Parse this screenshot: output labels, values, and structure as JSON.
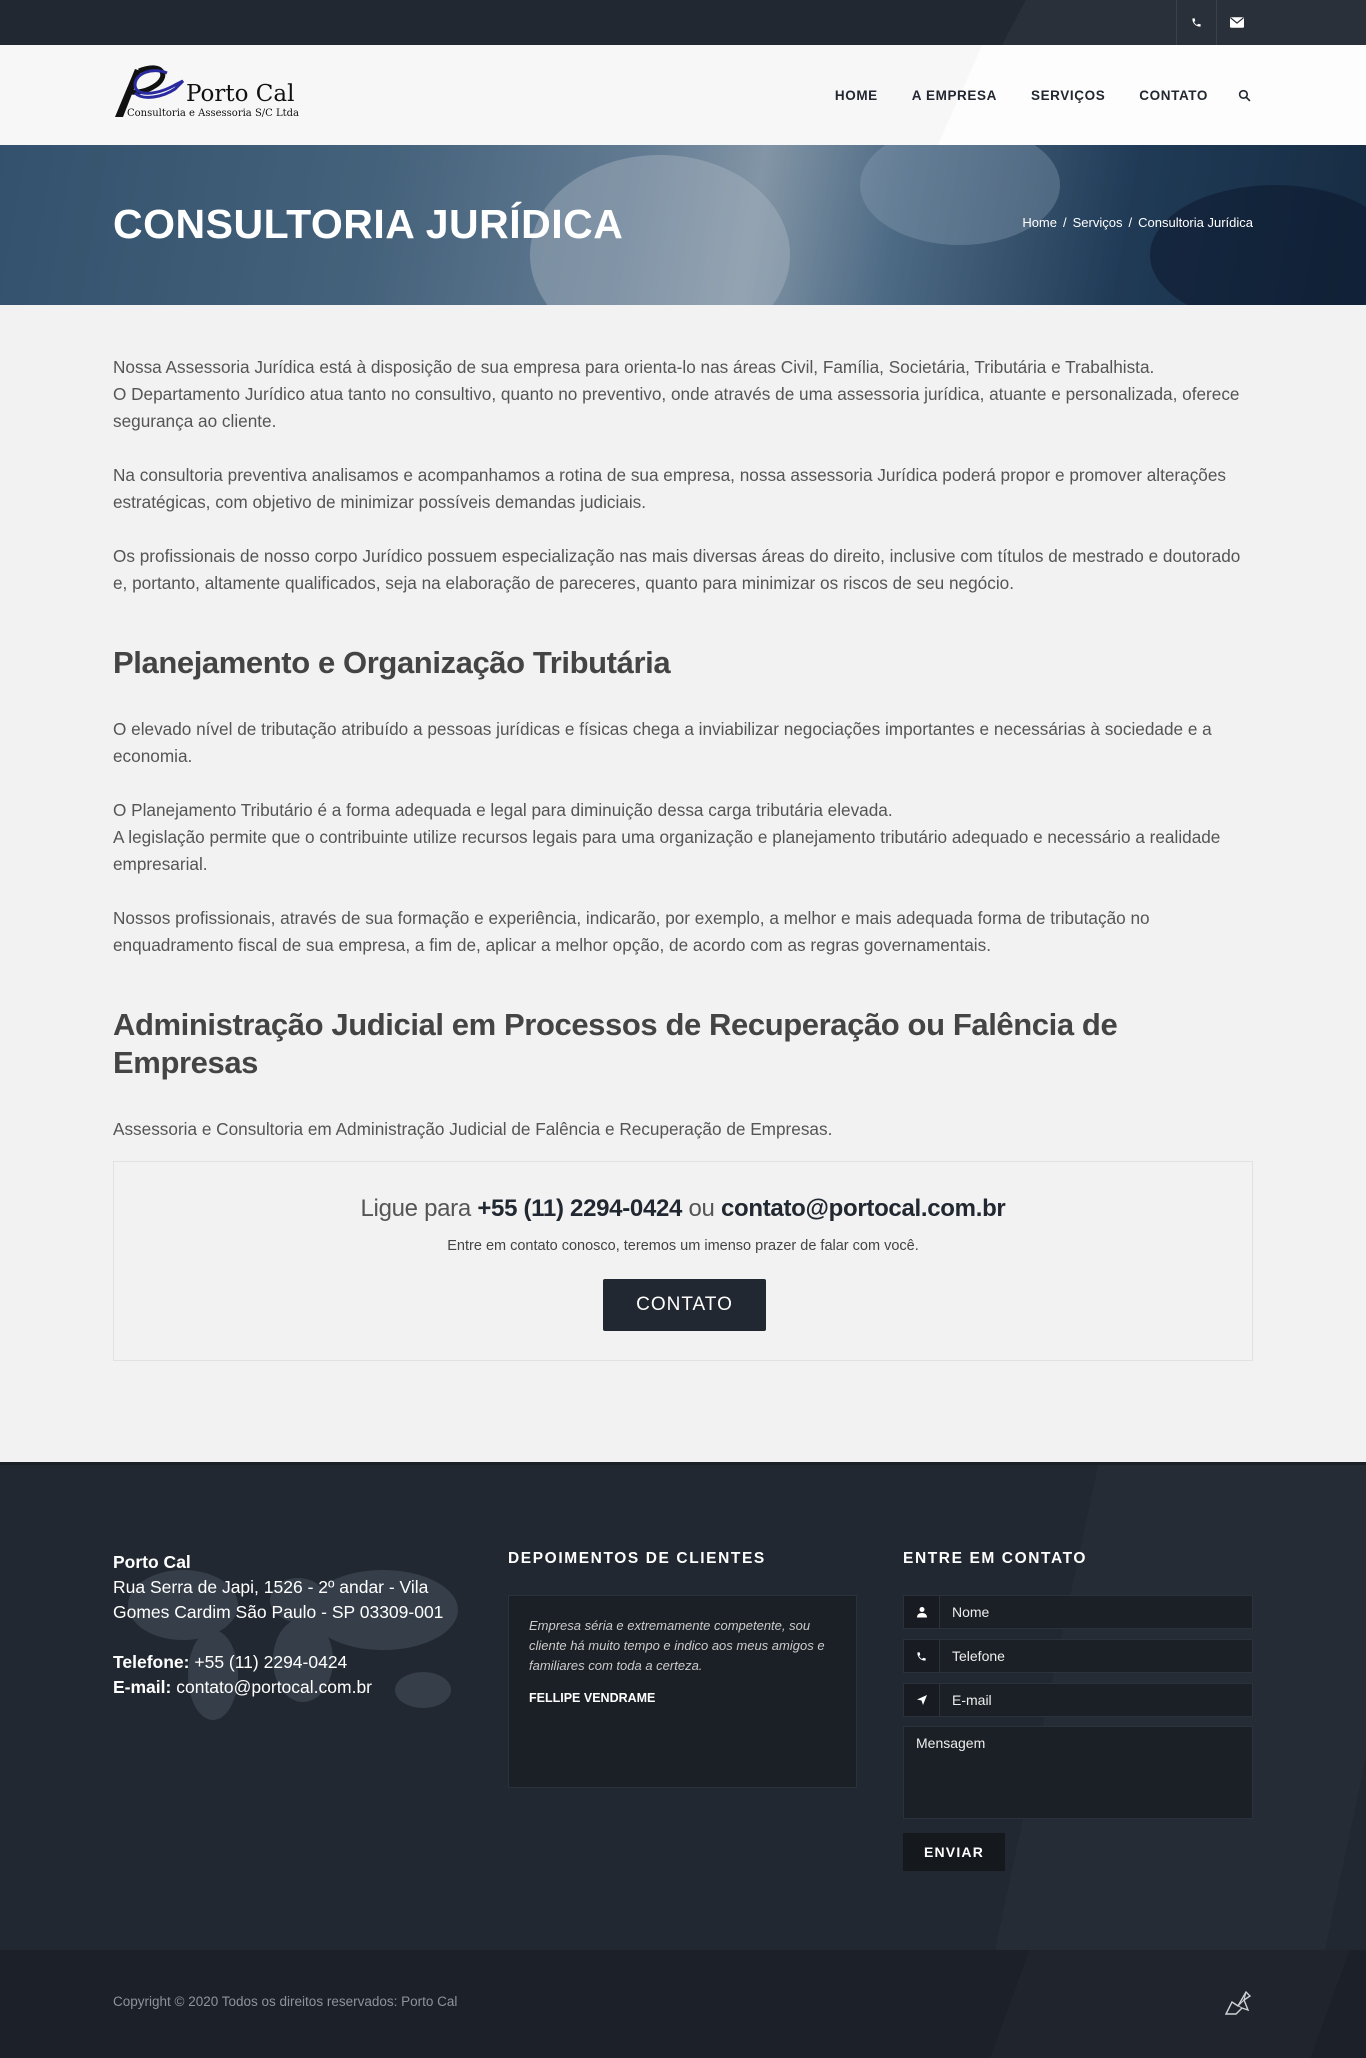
{
  "topbar": {
    "icons": [
      "phone-icon",
      "email-icon"
    ]
  },
  "header": {
    "logo": {
      "name": "Porto Cal",
      "subtitle": "Consultoria e Assessoria S/C Ltda"
    },
    "nav": [
      {
        "label": "HOME"
      },
      {
        "label": "A EMPRESA"
      },
      {
        "label": "SERVIÇOS"
      },
      {
        "label": "CONTATO"
      }
    ]
  },
  "banner": {
    "title": "CONSULTORIA JURÍDICA",
    "breadcrumb": {
      "home": "Home",
      "section": "Serviços",
      "current": "Consultoria Jurídica",
      "separator": "/"
    }
  },
  "content": {
    "intro": [
      "Nossa Assessoria Jurídica está à disposição de sua empresa para orienta-lo nas áreas Civil, Família, Societária, Tributária e Trabalhista.",
      "O Departamento Jurídico atua tanto no consultivo, quanto no preventivo, onde através de uma assessoria jurídica, atuante e personalizada, oferece segurança ao cliente.",
      "Na consultoria preventiva analisamos e acompanhamos a rotina de sua empresa, nossa assessoria Jurídica poderá propor e promover alterações estratégicas, com objetivo de minimizar possíveis demandas judiciais.",
      "Os profissionais de nosso corpo Jurídico possuem especialização nas mais diversas áreas do direito, inclusive com títulos de mestrado e doutorado e, portanto, altamente qualificados, seja na elaboração de pareceres, quanto para minimizar os riscos de seu negócio."
    ],
    "section1": {
      "heading": "Planejamento e Organização Tributária",
      "paragraphs": [
        "O elevado nível de tributação atribuído a pessoas jurídicas e físicas chega a inviabilizar negociações importantes e necessárias à sociedade e a economia.",
        "O Planejamento Tributário é a forma adequada e legal para diminuição dessa carga tributária elevada.",
        "A legislação permite que o contribuinte utilize recursos legais para uma organização e planejamento tributário adequado e necessário a realidade empresarial.",
        "Nossos profissionais, através de sua formação e experiência, indicarão, por exemplo, a melhor e mais adequada forma de tributação no enquadramento fiscal de sua empresa, a fim de, aplicar a melhor opção, de acordo com as regras governamentais."
      ]
    },
    "section2": {
      "heading": "Administração Judicial em Processos de Recuperação ou Falência de Empresas",
      "paragraphs": [
        "Assessoria e Consultoria em Administração Judicial de Falência e Recuperação de Empresas."
      ]
    }
  },
  "cta": {
    "prefix": "Ligue para",
    "phone": "+55 (11) 2294-0424",
    "joiner": "ou",
    "email": "contato@portocal.com.br",
    "subtitle": "Entre em contato conosco, teremos um imenso prazer de falar com você.",
    "button": "CONTATO"
  },
  "footer": {
    "address": {
      "company": "Porto Cal",
      "street": "Rua Serra de Japi, 1526 - 2º andar - Vila Gomes Cardim São Paulo - SP 03309-001",
      "phone_label": "Telefone:",
      "phone": "+55 (11) 2294-0424",
      "email_label": "E-mail:",
      "email": "contato@portocal.com.br"
    },
    "testimonials": {
      "title": "DEPOIMENTOS DE CLIENTES",
      "quote": "Empresa séria e extremamente competente, sou cliente há muito tempo e indico aos meus amigos e familiares com toda a certeza.",
      "author": "FELLIPE VENDRAME"
    },
    "contact_form": {
      "title": "ENTRE EM CONTATO",
      "name_placeholder": "Nome",
      "phone_placeholder": "Telefone",
      "email_placeholder": "E-mail",
      "message_placeholder": "Mensagem",
      "submit": "ENVIAR"
    }
  },
  "bottom": {
    "copyright": "Copyright © 2020 Todos os direitos reservados: Porto Cal"
  },
  "colors": {
    "dark": "#222831",
    "accent_logo": "#2a2aa0",
    "background": "#f2f2f2"
  }
}
